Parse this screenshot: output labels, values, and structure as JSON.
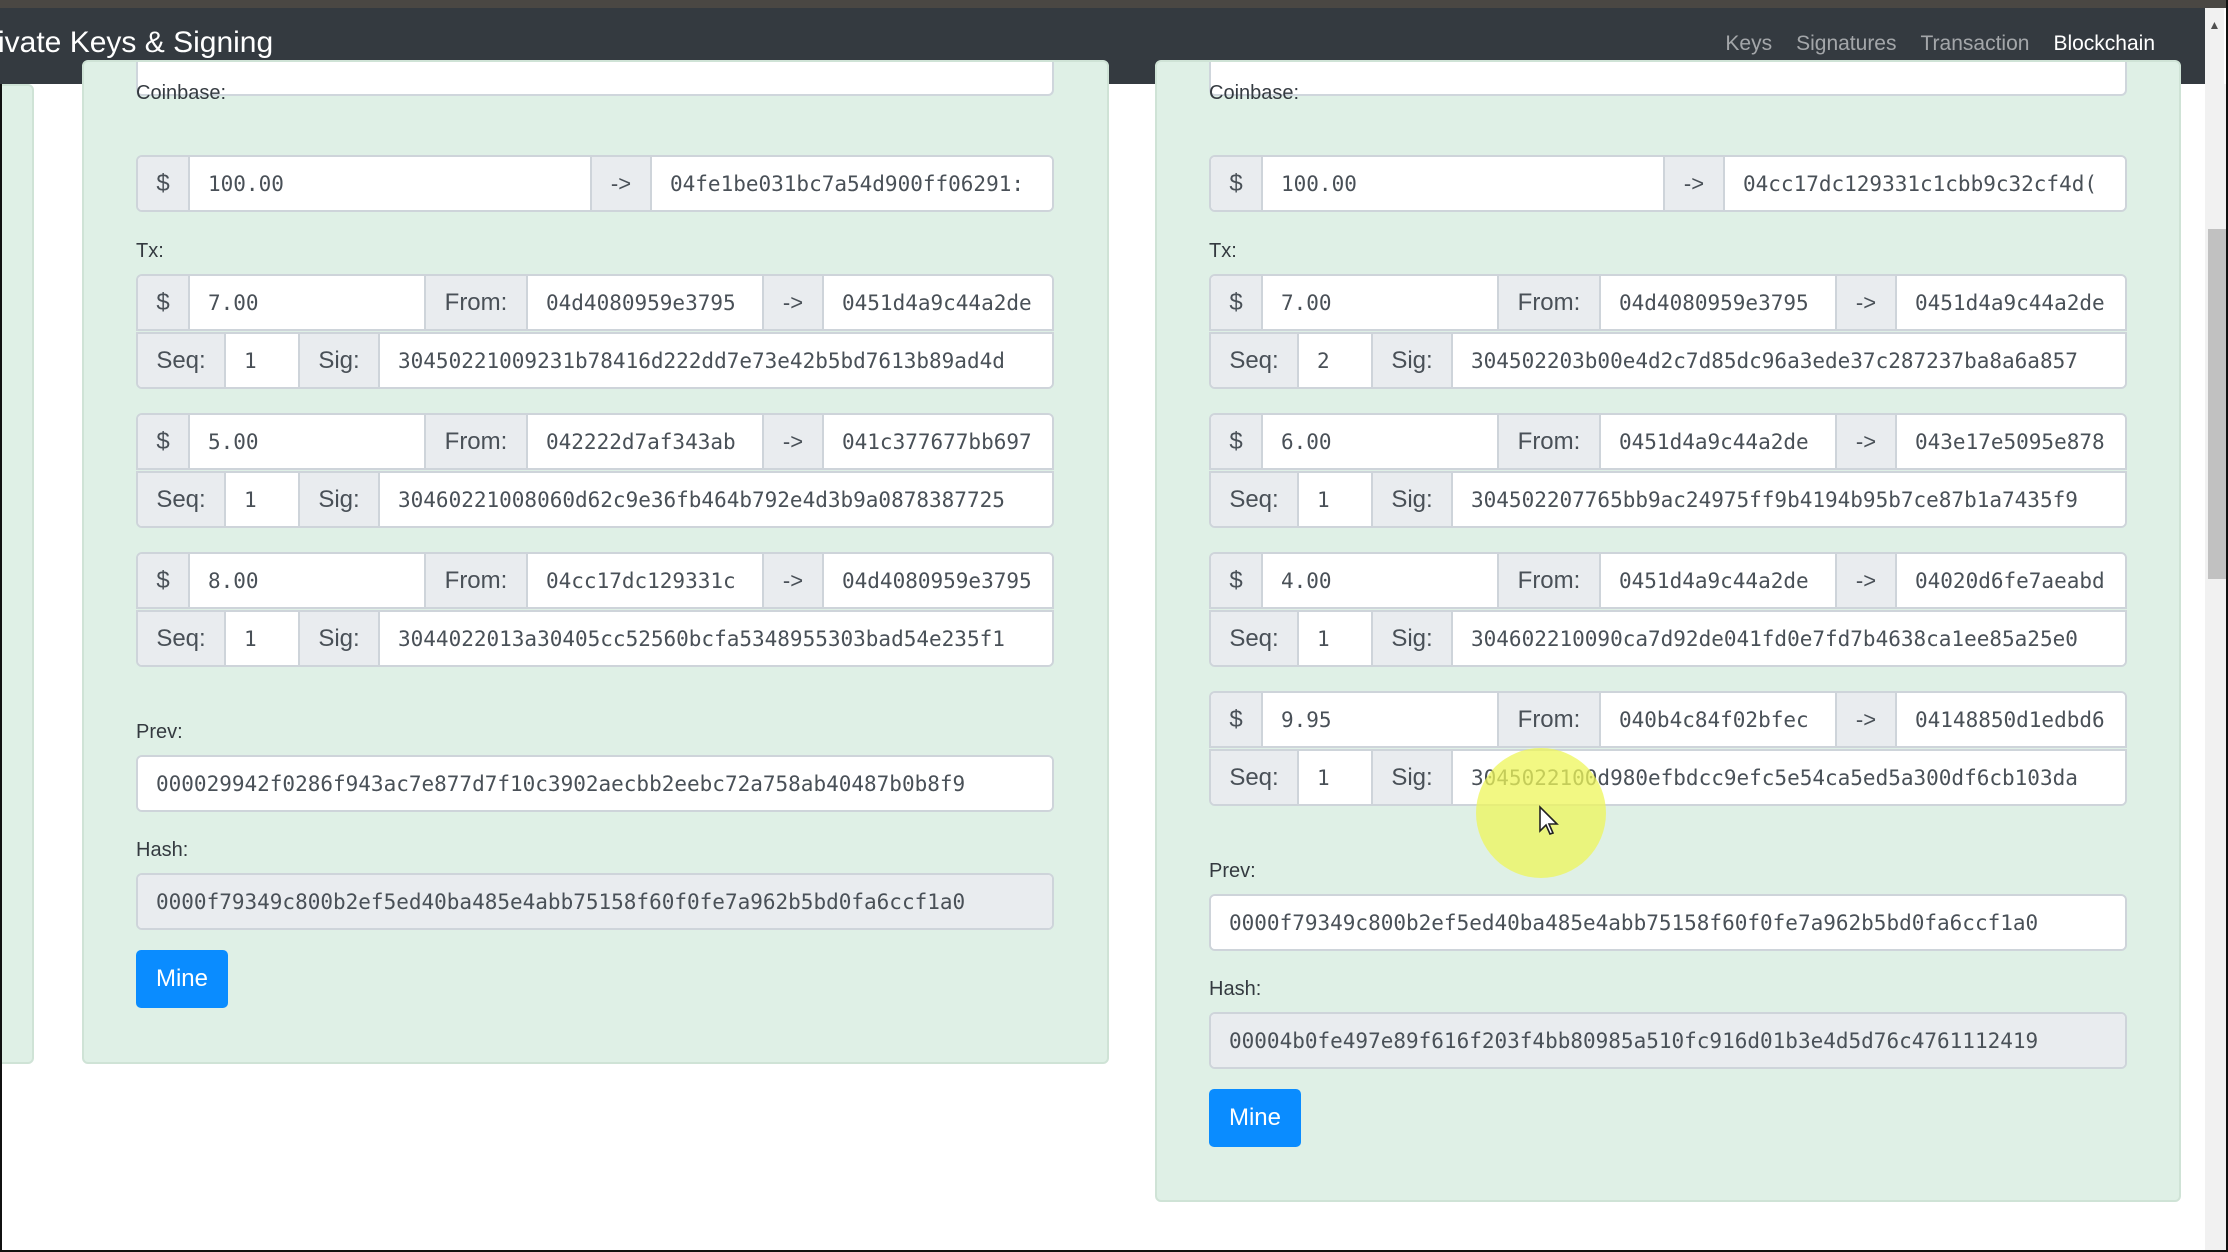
{
  "navbar": {
    "brand": "ivate Keys & Signing",
    "links": [
      {
        "label": "Keys",
        "active": false
      },
      {
        "label": "Signatures",
        "active": false
      },
      {
        "label": "Transaction",
        "active": false
      },
      {
        "label": "Blockchain",
        "active": true
      }
    ]
  },
  "labels": {
    "coinbase": "Coinbase:",
    "tx": "Tx:",
    "prev": "Prev:",
    "hash": "Hash:",
    "dollar": "$",
    "arrow": "->",
    "from": "From:",
    "seq": "Seq:",
    "sig": "Sig:",
    "mine": "Mine"
  },
  "blocks": [
    {
      "coinbase": {
        "amount": "100.00",
        "to": "04fe1be031bc7a54d900ff06291:"
      },
      "txs": [
        {
          "amount": "7.00",
          "from": "04d4080959e3795",
          "to": "0451d4a9c44a2de",
          "seq": "1",
          "sig": "30450221009231b78416d222dd7e73e42b5bd7613b89ad4d"
        },
        {
          "amount": "5.00",
          "from": "042222d7af343ab",
          "to": "041c377677bb697",
          "seq": "1",
          "sig": "30460221008060d62c9e36fb464b792e4d3b9a0878387725"
        },
        {
          "amount": "8.00",
          "from": "04cc17dc129331c",
          "to": "04d4080959e3795",
          "seq": "1",
          "sig": "3044022013a30405cc52560bcfa5348955303bad54e235f1"
        }
      ],
      "prev": "000029942f0286f943ac7e877d7f10c3902aecbb2eebc72a758ab40487b0b8f9",
      "hash": "0000f79349c800b2ef5ed40ba485e4abb75158f60f0fe7a962b5bd0fa6ccf1a0"
    },
    {
      "coinbase": {
        "amount": "100.00",
        "to": "04cc17dc129331c1cbb9c32cf4d("
      },
      "txs": [
        {
          "amount": "7.00",
          "from": "04d4080959e3795",
          "to": "0451d4a9c44a2de",
          "seq": "2",
          "sig": "304502203b00e4d2c7d85dc96a3ede37c287237ba8a6a857"
        },
        {
          "amount": "6.00",
          "from": "0451d4a9c44a2de",
          "to": "043e17e5095e878",
          "seq": "1",
          "sig": "304502207765bb9ac24975ff9b4194b95b7ce87b1a7435f9"
        },
        {
          "amount": "4.00",
          "from": "0451d4a9c44a2de",
          "to": "04020d6fe7aeabd",
          "seq": "1",
          "sig": "304602210090ca7d92de041fd0e7fd7b4638ca1ee85a25e0"
        },
        {
          "amount": "9.95",
          "from": "040b4c84f02bfec",
          "to": "04148850d1edbd6",
          "seq": "1",
          "sig": "3045022100d980efbdcc9efc5e54ca5ed5a300df6cb103da"
        }
      ],
      "prev": "0000f79349c800b2ef5ed40ba485e4abb75158f60f0fe7a962b5bd0fa6ccf1a0",
      "hash": "00004b0fe497e89f616f203f4bb80985a510fc916d01b3e4d5d76c4761112419"
    }
  ],
  "colors": {
    "navbar": "#343a40",
    "card_bg": "#dff0e6",
    "mine_button": "#0a8cff"
  }
}
